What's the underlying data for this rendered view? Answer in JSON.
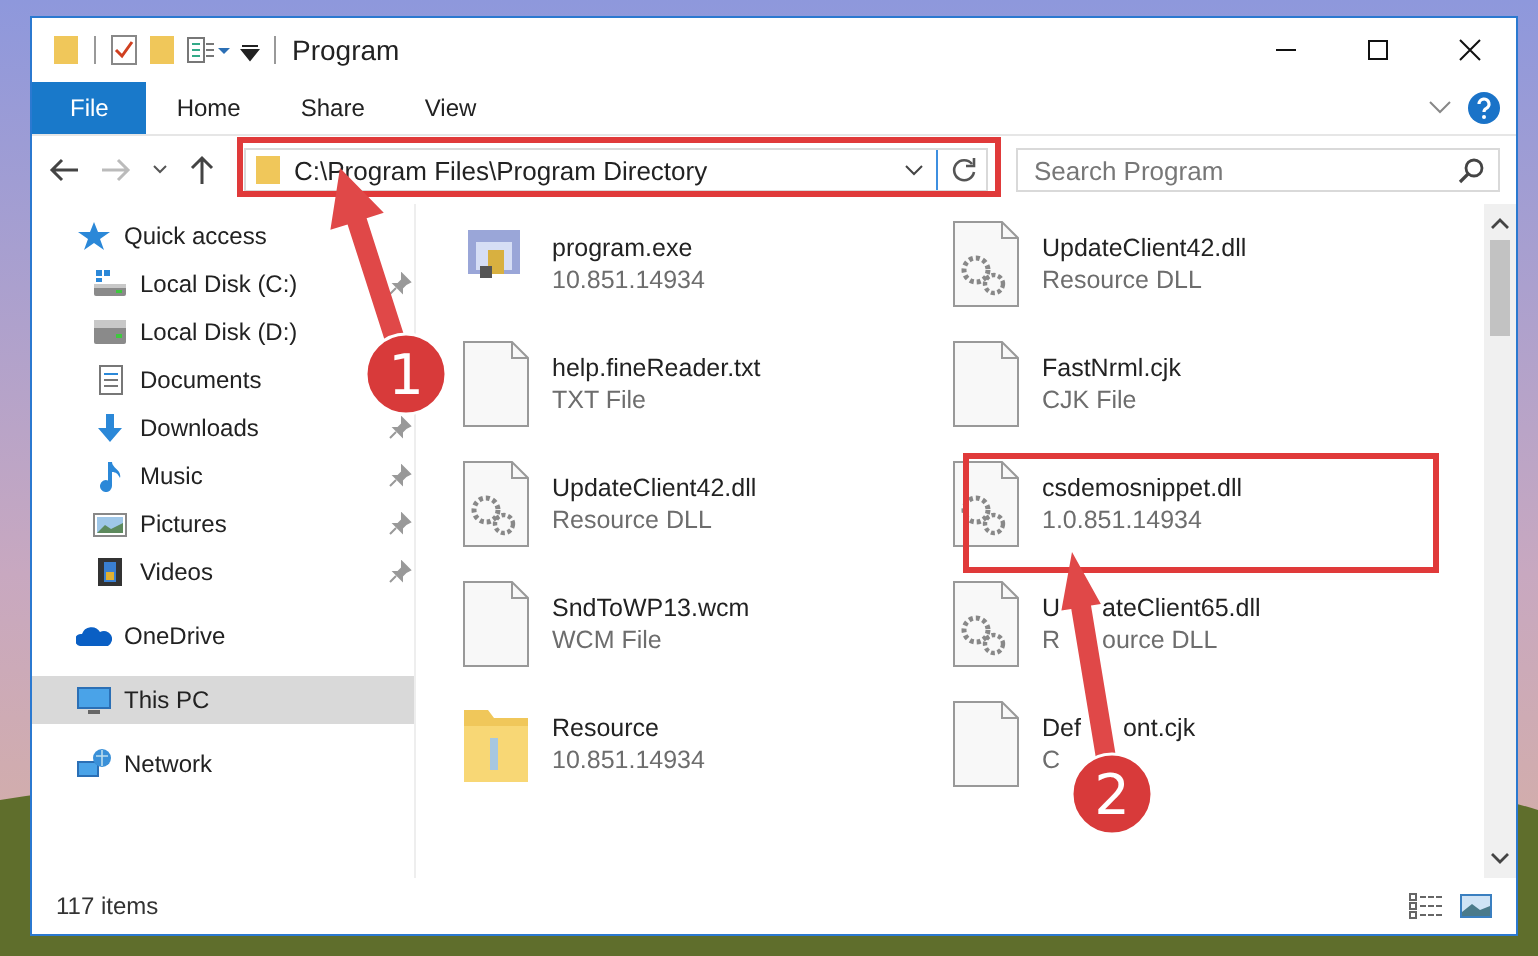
{
  "window": {
    "title": "Program"
  },
  "ribbon_tabs": [
    {
      "label": "File",
      "kind": "file",
      "selected": false
    },
    {
      "label": "Home",
      "kind": "tab",
      "selected": false
    },
    {
      "label": "Share",
      "kind": "tab",
      "selected": false
    },
    {
      "label": "View",
      "kind": "tab",
      "selected": false
    }
  ],
  "address": {
    "path": "C:\\Program Files\\Program Directory"
  },
  "search": {
    "placeholder": "Search Program"
  },
  "sidebar": {
    "items": [
      {
        "label": "Quick access",
        "selected": false,
        "children": [
          {
            "label": "Local Disk (C:)",
            "pinned": true
          },
          {
            "label": "Local Disk (D:)",
            "pinned": false
          },
          {
            "label": "Documents",
            "pinned": false
          },
          {
            "label": "Downloads",
            "pinned": true
          },
          {
            "label": "Music",
            "pinned": true
          },
          {
            "label": "Pictures",
            "pinned": true
          },
          {
            "label": "Videos",
            "pinned": true
          }
        ]
      },
      {
        "label": "OneDrive",
        "selected": false
      },
      {
        "label": "This PC",
        "selected": true
      },
      {
        "label": "Network",
        "selected": false
      }
    ]
  },
  "files": [
    {
      "name": [
        "program.exe"
      ],
      "detail": [
        "10.851.14934"
      ],
      "kind": "exe"
    },
    {
      "name": [
        "help.fineReader.txt"
      ],
      "detail": [
        "TXT File"
      ],
      "kind": "file"
    },
    {
      "name": [
        "UpdateClient42.dll"
      ],
      "detail": [
        "Resource DLL"
      ],
      "kind": "dll"
    },
    {
      "name": [
        "SndToWP13.wcm"
      ],
      "detail": [
        "WCM File"
      ],
      "kind": "file"
    },
    {
      "name": [
        "Resource"
      ],
      "detail": [
        "10.851.14934"
      ],
      "kind": "folder"
    },
    {
      "name": [
        "UpdateClient42.dll"
      ],
      "detail": [
        "Resource DLL"
      ],
      "kind": "dll"
    },
    {
      "name": [
        "FastNrml.cjk"
      ],
      "detail": [
        "CJK File"
      ],
      "kind": "file"
    },
    {
      "name": [
        "csdemosnippet.dll"
      ],
      "detail": [
        "1.0.851.14934"
      ],
      "kind": "dll"
    },
    {
      "name": [
        "U",
        "ateClient65.dll"
      ],
      "detail": [
        "R",
        "ource DLL"
      ],
      "kind": "dll"
    },
    {
      "name": [
        "Def",
        "ont.cjk"
      ],
      "detail": [
        "C"
      ],
      "kind": "file"
    }
  ],
  "status_bar": {
    "item_count": "117 items"
  },
  "annotations": [
    {
      "label": "1"
    },
    {
      "label": "2"
    }
  ]
}
